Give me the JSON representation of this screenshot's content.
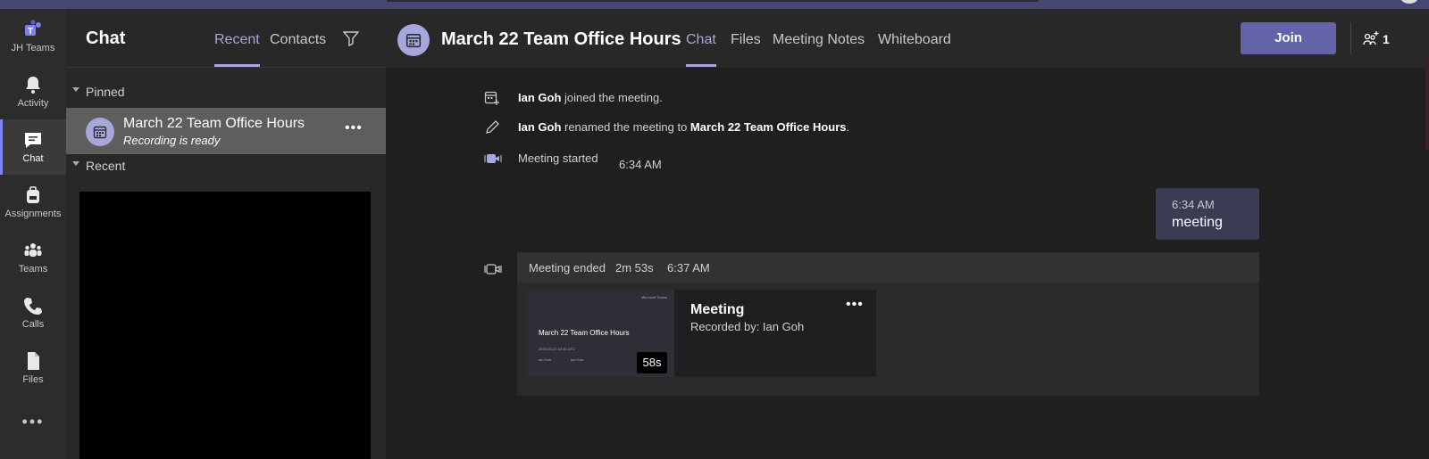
{
  "rail": {
    "items": [
      {
        "label": "JH Teams",
        "icon": "teams-logo-icon"
      },
      {
        "label": "Activity",
        "icon": "bell-icon"
      },
      {
        "label": "Chat",
        "icon": "chat-icon",
        "active": true
      },
      {
        "label": "Assignments",
        "icon": "backpack-icon"
      },
      {
        "label": "Teams",
        "icon": "people-group-icon"
      },
      {
        "label": "Calls",
        "icon": "phone-icon"
      },
      {
        "label": "Files",
        "icon": "file-icon"
      }
    ],
    "more": "•••"
  },
  "chat_list": {
    "title": "Chat",
    "tabs": [
      "Recent",
      "Contacts"
    ],
    "active_tab": "Recent",
    "sections": {
      "pinned": "Pinned",
      "recent": "Recent"
    },
    "pinned_item": {
      "name": "March 22 Team Office Hours",
      "status": "Recording is ready",
      "more": "•••"
    }
  },
  "header": {
    "title": "March 22 Team Office Hours",
    "tabs": [
      "Chat",
      "Files",
      "Meeting Notes",
      "Whiteboard"
    ],
    "active_tab": "Chat",
    "join_label": "Join",
    "participants_count": "1"
  },
  "messages": {
    "joined": {
      "user": "Ian Goh",
      "text": " joined the meeting."
    },
    "renamed": {
      "user": "Ian Goh",
      "text": " renamed the meeting to ",
      "new_name": "March 22 Team Office Hours",
      "end": "."
    },
    "started": {
      "text": "Meeting started",
      "time": "6:34 AM"
    },
    "bubble": {
      "time": "6:34 AM",
      "text": "meeting"
    },
    "ended": {
      "text": "Meeting ended",
      "duration": "2m 53s",
      "time": "6:37 AM",
      "recording": {
        "thumb_brand": "Microsoft Teams",
        "thumb_title": "March 22 Team Office Hours",
        "thumb_meta": "2020-03-22 10:34 UTC",
        "thumb_organizer": "Ian Goh",
        "thumb_recorded": "Ian Goh",
        "duration_badge": "58s",
        "name": "Meeting",
        "recorded_by": "Recorded by: Ian Goh",
        "more": "•••"
      }
    }
  },
  "colors": {
    "accent": "#6264a7",
    "accent_light": "#a6a7dc",
    "rail_bg": "#2d2c2c",
    "list_bg": "#292828",
    "main_bg": "#1f1f1f"
  }
}
